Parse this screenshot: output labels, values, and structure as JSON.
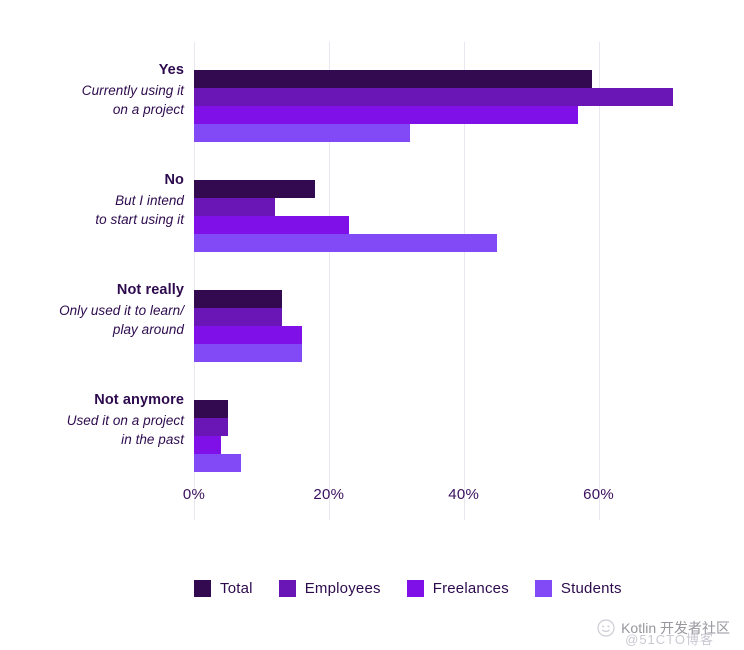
{
  "chart_data": {
    "type": "bar",
    "orientation": "horizontal",
    "title": "",
    "xlabel": "",
    "ylabel": "",
    "xlim": [
      0,
      70
    ],
    "grid": true,
    "legend_position": "bottom",
    "xticks": [
      "0%",
      "20%",
      "40%",
      "60%"
    ],
    "xtick_values": [
      0,
      20,
      40,
      60
    ],
    "categories": [
      {
        "label": "Yes",
        "sublabel_line1": "Currently using it",
        "sublabel_line2": "on a project"
      },
      {
        "label": "No",
        "sublabel_line1": "But I intend",
        "sublabel_line2": "to start using it"
      },
      {
        "label": "Not really",
        "sublabel_line1": "Only used it to learn/",
        "sublabel_line2": "play around"
      },
      {
        "label": "Not anymore",
        "sublabel_line1": "Used it on a project",
        "sublabel_line2": "in the past"
      }
    ],
    "series": [
      {
        "name": "Total",
        "color": "#330a4f",
        "values": [
          59,
          18,
          13,
          5
        ]
      },
      {
        "name": "Employees",
        "color": "#6a15b5",
        "values": [
          71,
          12,
          13,
          5
        ]
      },
      {
        "name": "Freelances",
        "color": "#7f11e8",
        "values": [
          57,
          23,
          16,
          4
        ]
      },
      {
        "name": "Students",
        "color": "#8249f7",
        "values": [
          32,
          45,
          16,
          7
        ]
      }
    ]
  },
  "legend": {
    "items": [
      {
        "label": "Total",
        "color": "#330a4f"
      },
      {
        "label": "Employees",
        "color": "#6a15b5"
      },
      {
        "label": "Freelances",
        "color": "#7f11e8"
      },
      {
        "label": "Students",
        "color": "#8249f7"
      }
    ]
  },
  "footer": {
    "brand": "Kotlin 开发者社区",
    "watermark": "@51CTO博客"
  },
  "theme": {
    "background": "#ffffff",
    "gridline": "#e9e7ef",
    "text": "#2d0a4e"
  }
}
